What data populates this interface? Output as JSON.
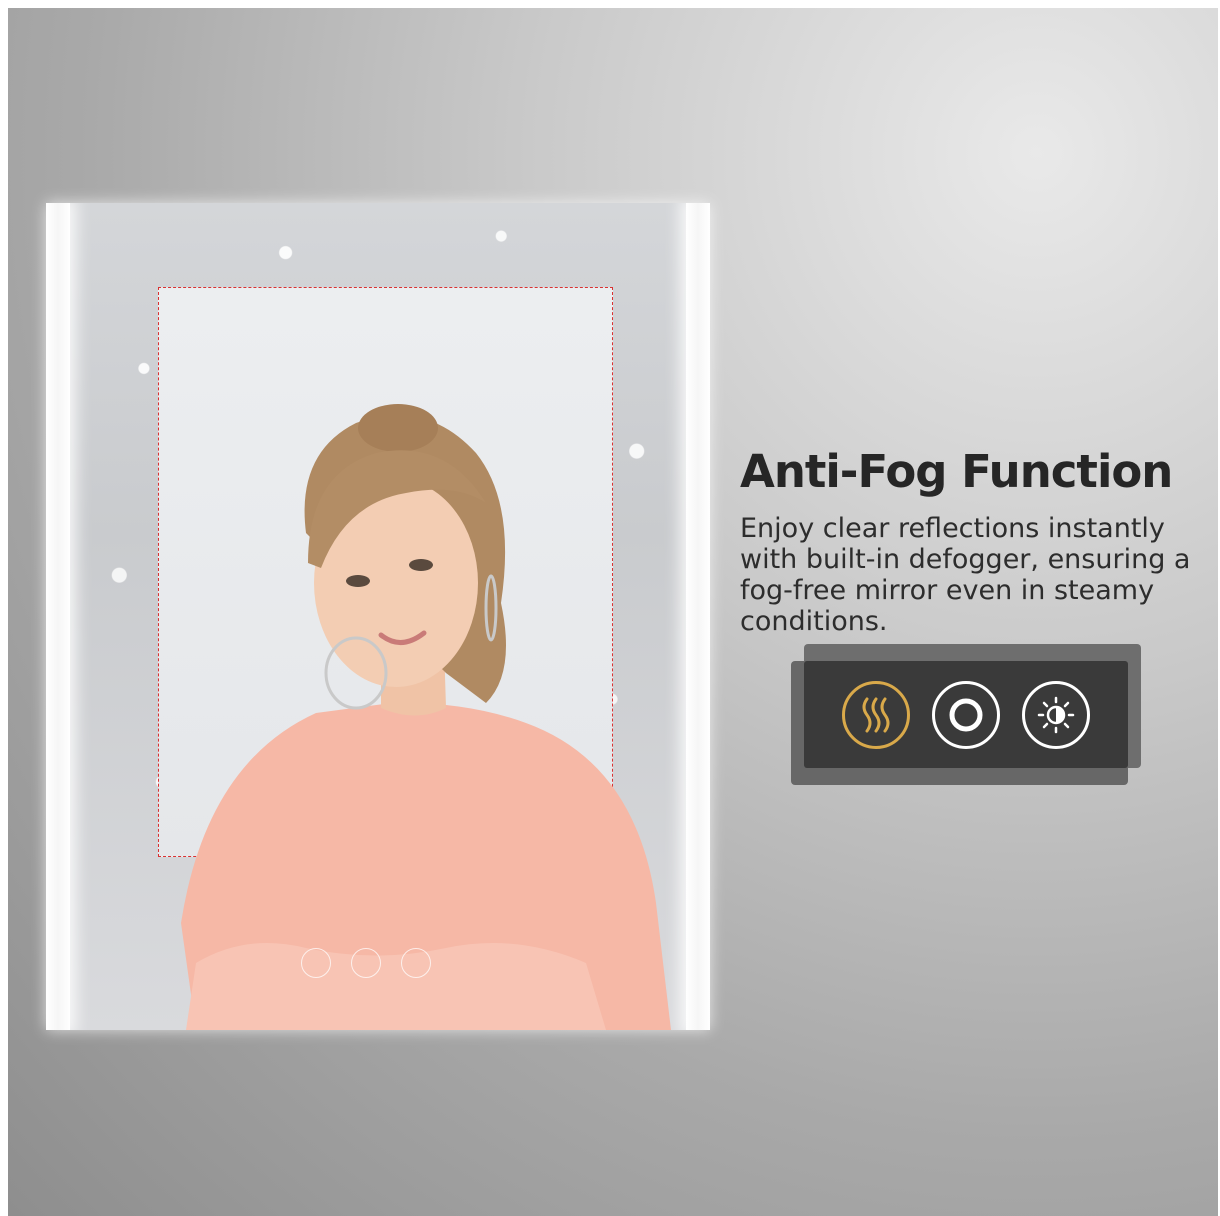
{
  "feature": {
    "title": "Anti-Fog Function",
    "description": "Enjoy clear reflections instantly with built-in defogger, ensuring a fog-free mirror even in steamy conditions."
  },
  "controls": [
    {
      "icon": "defogger-icon",
      "color": "#d9a94a"
    },
    {
      "icon": "power-icon",
      "color": "#ffffff"
    },
    {
      "icon": "brightness-icon",
      "color": "#ffffff"
    }
  ],
  "colors": {
    "clear_zone_border": "#d93232",
    "panel": "#3a3a3a",
    "accent": "#d9a94a"
  }
}
